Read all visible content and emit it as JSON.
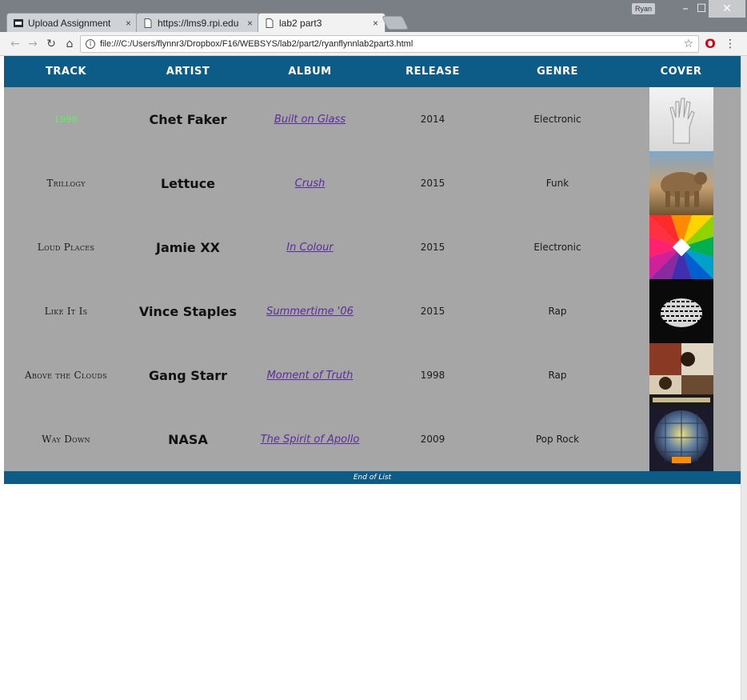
{
  "browser": {
    "tabs": [
      {
        "label": "Upload Assignment",
        "close": "×",
        "icon": "blackboard-icon"
      },
      {
        "label": "https://lms9.rpi.edu",
        "close": "×",
        "icon": "page-icon"
      },
      {
        "label": "lab2 part3",
        "close": "×",
        "icon": "page-icon"
      }
    ],
    "user_badge": "Ryan",
    "url": "file:///C:/Users/flynnr3/Dropbox/F16/WEBSYS/lab2/part2/ryanflynnlab2part3.html"
  },
  "table": {
    "headers": [
      "TRACK",
      "ARTIST",
      "ALBUM",
      "RELEASE",
      "GENRE",
      "COVER"
    ],
    "rows": [
      {
        "track": "1998",
        "artist": "Chet Faker",
        "album": "Built on Glass",
        "release": "2014",
        "genre": "Electronic",
        "cover": "built-on-glass-cover"
      },
      {
        "track": "Trillogy",
        "artist": "Lettuce",
        "album": "Crush",
        "release": "2015",
        "genre": "Funk",
        "cover": "crush-cover"
      },
      {
        "track": "Loud Places",
        "artist": "Jamie XX",
        "album": "In Colour",
        "release": "2015",
        "genre": "Electronic",
        "cover": "in-colour-cover"
      },
      {
        "track": "Like It Is",
        "artist": "Vince Staples",
        "album": "Summertime '06",
        "release": "2015",
        "genre": "Rap",
        "cover": "summertime-06-cover"
      },
      {
        "track": "Above the Clouds",
        "artist": "Gang Starr",
        "album": "Moment of Truth",
        "release": "1998",
        "genre": "Rap",
        "cover": "moment-of-truth-cover"
      },
      {
        "track": "Way Down",
        "artist": "NASA",
        "album": "The Spirit of Apollo",
        "release": "2009",
        "genre": "Pop Rock",
        "cover": "spirit-of-apollo-cover"
      }
    ],
    "footer": "End of List"
  },
  "colors": {
    "header_bg": "#0d5c87",
    "row_bg": "#a6a6a6",
    "link": "#5b2b9e",
    "first_track": "#4dff4d"
  }
}
